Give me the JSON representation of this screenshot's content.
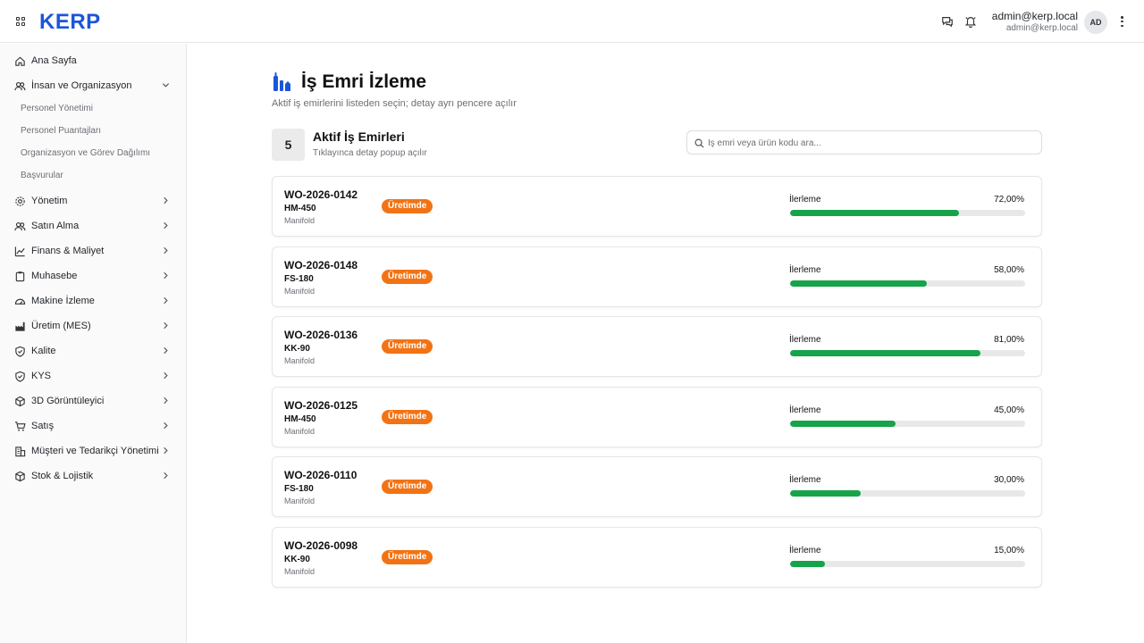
{
  "header": {
    "logo": "KERP",
    "user_name": "admin@kerp.local",
    "user_email": "admin@kerp.local",
    "avatar_initials": "AD",
    "icons": [
      "grid-icon",
      "chat-icon",
      "bell-icon",
      "more-vertical-icon"
    ]
  },
  "sidebar": {
    "items": [
      {
        "label": "Ana Sayfa",
        "icon": "home-icon",
        "expanded": false,
        "has_chevron": false
      },
      {
        "label": "İnsan ve Organizasyon",
        "icon": "users-icon",
        "expanded": true,
        "has_chevron": true
      },
      {
        "label": "Yönetim",
        "icon": "gear-icon",
        "has_chevron": true
      },
      {
        "label": "Satın Alma",
        "icon": "users-icon",
        "has_chevron": true
      },
      {
        "label": "Finans & Maliyet",
        "icon": "chart-line-icon",
        "has_chevron": true
      },
      {
        "label": "Muhasebe",
        "icon": "clipboard-icon",
        "has_chevron": true
      },
      {
        "label": "Makine İzleme",
        "icon": "gauge-icon",
        "has_chevron": true
      },
      {
        "label": "Üretim (MES)",
        "icon": "factory-icon",
        "has_chevron": true
      },
      {
        "label": "Kalite",
        "icon": "shield-check-icon",
        "has_chevron": true
      },
      {
        "label": "KYS",
        "icon": "shield-check-icon",
        "has_chevron": true
      },
      {
        "label": "3D Görüntüleyici",
        "icon": "cube-icon",
        "has_chevron": true
      },
      {
        "label": "Satış",
        "icon": "cart-icon",
        "has_chevron": true
      },
      {
        "label": "Müşteri ve Tedarikçi Yönetimi",
        "icon": "building-icon",
        "has_chevron": true
      },
      {
        "label": "Stok & Lojistik",
        "icon": "box-icon",
        "has_chevron": true
      }
    ],
    "sub_items": [
      "Personel Yönetimi",
      "Personel Puantajları",
      "Organizasyon ve Görev Dağılımı",
      "Başvurular"
    ]
  },
  "main": {
    "title": "İş Emri İzleme",
    "subtitle": "Aktif iş emirlerini listeden seçin; detay ayrı pencere açılır",
    "count": "5",
    "list_title": "Aktif İş Emirleri",
    "list_subtitle": "Tıklayınca detay popup açılır",
    "search_placeholder": "İş emri veya ürün kodu ara...",
    "progress_label": "İlerleme",
    "accent_color": "#1a56db",
    "badge_color": "#f27314",
    "progress_color": "#16a34a",
    "work_orders": [
      {
        "id": "WO-2026-0142",
        "product": "HM-450",
        "type": "Manifold",
        "status": "Üretimde",
        "progress": 72,
        "progress_text": "72,00%"
      },
      {
        "id": "WO-2026-0148",
        "product": "FS-180",
        "type": "Manifold",
        "status": "Üretimde",
        "progress": 58,
        "progress_text": "58,00%"
      },
      {
        "id": "WO-2026-0136",
        "product": "KK-90",
        "type": "Manifold",
        "status": "Üretimde",
        "progress": 81,
        "progress_text": "81,00%"
      },
      {
        "id": "WO-2026-0125",
        "product": "HM-450",
        "type": "Manifold",
        "status": "Üretimde",
        "progress": 45,
        "progress_text": "45,00%"
      },
      {
        "id": "WO-2026-0110",
        "product": "FS-180",
        "type": "Manifold",
        "status": "Üretimde",
        "progress": 30,
        "progress_text": "30,00%"
      },
      {
        "id": "WO-2026-0098",
        "product": "KK-90",
        "type": "Manifold",
        "status": "Üretimde",
        "progress": 15,
        "progress_text": "15,00%"
      }
    ]
  }
}
